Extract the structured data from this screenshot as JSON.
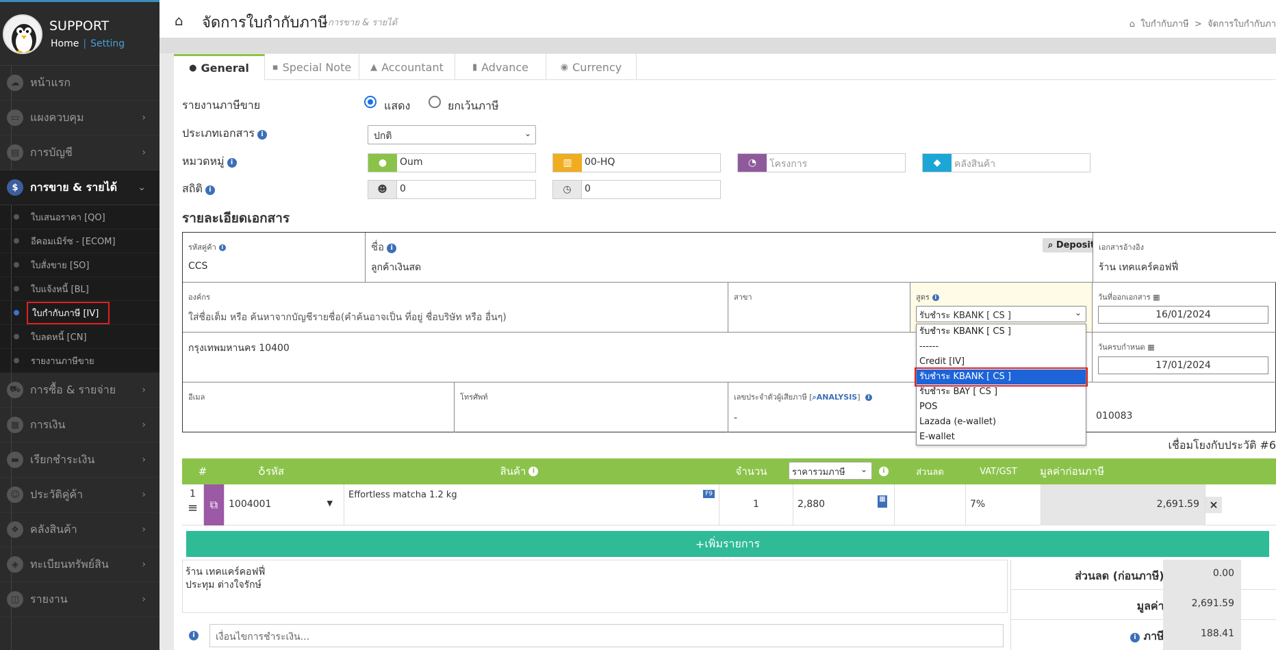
{
  "app": {
    "name": "SUPPORT",
    "home_link": "Home",
    "setting_link": "Setting"
  },
  "sidebar": {
    "items": [
      {
        "label": "หน้าแรก",
        "icon": "cloud-icon"
      },
      {
        "label": "แผงควบคุม",
        "icon": "monitor-icon"
      },
      {
        "label": "การบัญชี",
        "icon": "book-icon"
      },
      {
        "label": "การขาย & รายได้",
        "icon": "dollar-icon"
      },
      {
        "label": "การซื้อ & รายจ่าย",
        "icon": "cart-icon"
      },
      {
        "label": "การเงิน",
        "icon": "calendar-icon"
      },
      {
        "label": "เรียกชำระเงิน",
        "icon": "card-icon"
      },
      {
        "label": "ประวัติคู่ค้า",
        "icon": "contact-icon"
      },
      {
        "label": "คลังสินค้า",
        "icon": "cubes-icon"
      },
      {
        "label": "ทะเบียนทรัพย์สิน",
        "icon": "asset-icon"
      },
      {
        "label": "รายงาน",
        "icon": "report-icon"
      }
    ],
    "sub_items": [
      "ใบเสนอราคา [QO]",
      "อีคอมเมิร์ซ - [ECOM]",
      "ใบสั่งขาย [SO]",
      "ใบแจ้งหนี้ [BL]",
      "ใบกำกับภาษี [IV]",
      "ใบลดหนี้ [CN]",
      "รายงานภาษีขาย"
    ]
  },
  "header": {
    "title": "จัดการใบกำกับภาษี",
    "subtitle": "การขาย & รายได้",
    "breadcrumb_1": "ใบกำกับภาษี",
    "breadcrumb_sep": ">",
    "breadcrumb_2": "จัดการใบกำกับภา"
  },
  "tabs": [
    "General",
    "Special Note",
    "Accountant",
    "Advance",
    "Currency"
  ],
  "form": {
    "tax_report_label": "รายงานภาษีขาย",
    "radio_show": "แสดง",
    "radio_exempt": "ยกเว้นภาษี",
    "doc_type_label": "ประเภทเอกสาร",
    "doc_type_value": "ปกติ",
    "category_label": "หมวดหมู่",
    "user_value": "Oum",
    "branch_value": "00-HQ",
    "project_placeholder": "โครงการ",
    "warehouse_placeholder": "คลังสินค้า",
    "stat_label": "สถิติ",
    "stat_group_value": "0",
    "stat_time_value": "0"
  },
  "detail": {
    "section_title": "รายละเอียดเอกสาร",
    "customer_code_caption": "รหัสคู่ค้า",
    "customer_code": "CCS",
    "name_caption": "ชื่อ",
    "name_value": "ลูกค้าเงินสด",
    "deposit_label": "Deposit",
    "ref_doc_caption": "เอกสารอ้างอิง",
    "ref_doc_value": "ร้าน เทคแคร์คอฟฟี่",
    "org_caption": "องค์กร",
    "org_hint": "ใส่ชื่อเต็ม หรือ ค้นหาจากบัญชีรายชื่อ(คำค้นอาจเป็น ที่อยู่ ชื่อบริษัท หรือ อื่นๆ)",
    "branch_caption": "สาขา",
    "formula_caption": "สูตร",
    "formula_value": "รับชำระ KBANK [ CS ]",
    "issue_date_caption": "วันที่ออกเอกสาร",
    "issue_date": "16/01/2024",
    "address": "กรุงเทพมหานคร 10400",
    "due_date_caption": "วันครบกำหนด",
    "due_date": "17/01/2024",
    "email_caption": "อีเมล",
    "phone_caption": "โทรศัพท์",
    "tax_id_caption": "เลขประจำตัวผู้เสียภาษี",
    "analysis_link": "ANALYSIS",
    "tax_id_value": "-",
    "partial_value": "010083",
    "history_link": "เชื่อมโยงกับประวัติ #6"
  },
  "dropdown_options": [
    "รับชำระ KBANK [ CS ]",
    "------",
    "Credit [IV]",
    "รับชำระ KBANK [ CS ]",
    "รับชำระ BAY [ CS ]",
    "POS",
    "Lazada (e-wallet)",
    "E-wallet"
  ],
  "items_table": {
    "headers": {
      "num": "#",
      "code": "รหัส",
      "product": "สินค้า",
      "qty": "จำนวน",
      "price_select": "ราคารวมภาษี",
      "discount": "ส่วนลด",
      "vat": "VAT/GST",
      "pretax": "มูลค่าก่อนภาษี"
    },
    "rows": [
      {
        "no": "1",
        "code": "1004001",
        "product": "Effortless matcha 1.2 kg",
        "f9": "F9",
        "qty": "1",
        "price": "2,880",
        "discount": "",
        "vat": "7%",
        "pretax": "2,691.59"
      }
    ],
    "add_row_label": "เพิ่มรายการ"
  },
  "notes": {
    "line1": "ร้าน เทคแคร์คอฟฟี่",
    "line2": "ประทุม ต่างใจรักษ์"
  },
  "payment_placeholder": "เงื่อนไขการชำระเงิน...",
  "summary": {
    "discount_label": "ส่วนลด (ก่อนภาษี):",
    "discount_value": "0.00",
    "value_label": "มูลค่า:",
    "value_value": "2,691.59",
    "tax_label": "ภาษี:",
    "tax_value": "188.41"
  },
  "colors": {
    "green": "#8bc34a",
    "teal": "#2fbb96",
    "blue": "#1d64d8",
    "sidebar": "#2b2b2b"
  }
}
